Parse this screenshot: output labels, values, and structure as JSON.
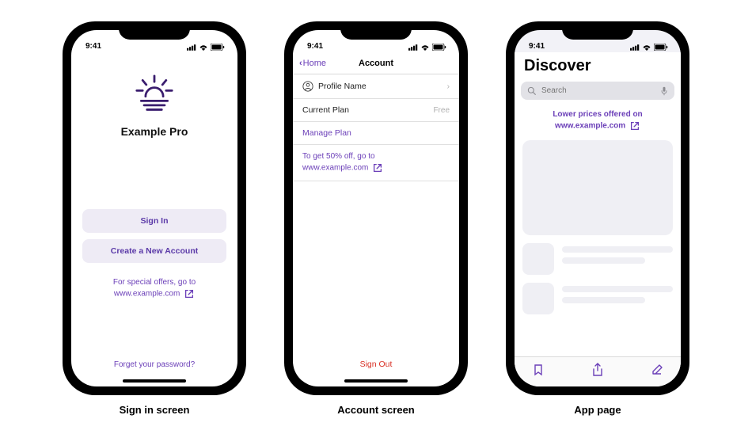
{
  "status": {
    "time": "9:41"
  },
  "colors": {
    "accent": "#6b3fb8",
    "logo": "#3a1d6e",
    "btnBg": "#eeebf5",
    "destructive": "#d93025"
  },
  "captions": {
    "c1": "Sign in screen",
    "c2": "Account screen",
    "c3": "App page"
  },
  "signin": {
    "appTitle": "Example Pro",
    "signInLabel": "Sign In",
    "createLabel": "Create a New Account",
    "offerLine1": "For special offers, go to",
    "offerLine2": "www.example.com",
    "forgot": "Forget your password?"
  },
  "account": {
    "back": "Home",
    "title": "Account",
    "profileRow": "Profile Name",
    "planLabel": "Current Plan",
    "planValue": "Free",
    "manage": "Manage Plan",
    "promoLine1": "To get 50% off, go to",
    "promoLine2": "www.example.com",
    "signOut": "Sign Out"
  },
  "discover": {
    "title": "Discover",
    "searchPlaceholder": "Search",
    "promoLine1": "Lower prices offered on",
    "promoLine2": "www.example.com"
  }
}
